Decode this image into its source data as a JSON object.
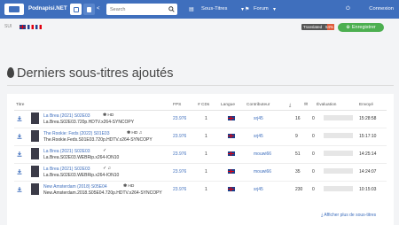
{
  "navbar": {
    "brand": "Podnapisi.NET",
    "search_placeholder": "Search",
    "subtitles_label": "Sous-Titres",
    "forum_label": "Forum",
    "login_label": "Connexion"
  },
  "subbar": {
    "label": "SUI",
    "progress_label": "Translated",
    "progress_percent": "54%",
    "progress_value": 0.54,
    "register_label": "Enregistrer"
  },
  "page": {
    "title": "Derniers sous-titres ajoutés"
  },
  "table": {
    "headers": {
      "title": "Titre",
      "fps": "FPS",
      "cds": "# CDs",
      "lang": "Langue",
      "contrib": "Contributeur",
      "eval": "Évaluation",
      "date": "Envoyé"
    },
    "rows": [
      {
        "title": "La Brea (2021) S02E03",
        "marks": "✽ HD",
        "file": "La.Brea.S02E03.720p.HDTV.x264-SYNCOPY",
        "fps": "23.976",
        "cds": "1",
        "contrib": "srj45",
        "downloads": "16",
        "comments": "0",
        "date": "15:28:58"
      },
      {
        "title": "The Rookie: Feds (2022) S01E03",
        "marks": "✽ HD ♫",
        "file": "The.Rookie.Feds.S01E03.720p.HDTV.x264-SYNCOPY",
        "fps": "23.976",
        "cds": "1",
        "contrib": "srj45",
        "downloads": "9",
        "comments": "0",
        "date": "15:17:10"
      },
      {
        "title": "La Brea (2021) S02E03",
        "marks": "✓",
        "file": "La.Brea.S02E03.WEBRip.x264-ION10",
        "fps": "23.976",
        "cds": "1",
        "contrib": "mouwi66",
        "downloads": "51",
        "comments": "0",
        "date": "14:25:14"
      },
      {
        "title": "La Brea (2021) S02E03",
        "marks": "✓ ♫",
        "file": "La.Brea.S02E03.WEBRip.x264-ION10",
        "fps": "23.976",
        "cds": "1",
        "contrib": "mouwi66",
        "downloads": "35",
        "comments": "0",
        "date": "14:24:07"
      },
      {
        "title": "New Amsterdam (2018) S05E04",
        "marks": "✽ HD",
        "file": "New.Amsterdam.2018.S05E04.720p.HDTV.x264-SYNCOPY",
        "fps": "23.976",
        "cds": "1",
        "contrib": "srj45",
        "downloads": "230",
        "comments": "0",
        "date": "10:15:03"
      }
    ],
    "more_label": "Afficher plus de sous-titres"
  },
  "colors": {
    "navbar": "#3f6fbd",
    "link": "#3f6fbd",
    "register": "#4caf50",
    "progress": "#e05c3a"
  }
}
